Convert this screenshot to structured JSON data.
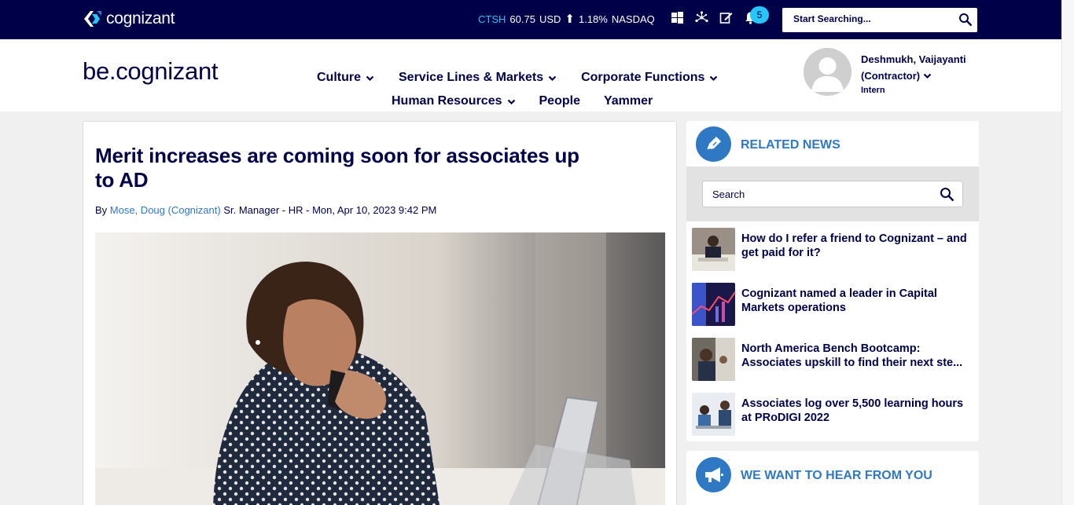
{
  "topbar": {
    "logo_text": "cognizant",
    "stock": {
      "ticker": "CTSH",
      "price": "60.75",
      "currency": "USD",
      "arrow": "⬆",
      "change": "1.18%",
      "exchange": "NASDAQ"
    },
    "icons": [
      "windows-icon",
      "network-icon",
      "edit-icon",
      "bell-icon"
    ],
    "notification_count": "5",
    "search_placeholder": "Start Searching..."
  },
  "header": {
    "brand": "be.cognizant",
    "nav_row1": [
      {
        "label": "Culture",
        "dropdown": true
      },
      {
        "label": "Service Lines & Markets",
        "dropdown": true
      },
      {
        "label": "Corporate Functions",
        "dropdown": true
      }
    ],
    "nav_row2": [
      {
        "label": "Human Resources",
        "dropdown": true
      },
      {
        "label": "People",
        "dropdown": false
      },
      {
        "label": "Yammer",
        "dropdown": false
      }
    ],
    "user": {
      "name_line1": "Deshmukh, Vaijayanti",
      "name_line2": "(Contractor)",
      "role": "Intern"
    }
  },
  "article": {
    "title": "Merit increases are coming soon for associates up to AD",
    "byline_prefix": "By",
    "author": "Mose, Doug (Cognizant)",
    "author_title": "Sr. Manager - HR",
    "separator": "-",
    "date": "Mon, Apr 10, 2023 9:42 PM"
  },
  "related_news": {
    "title": "RELATED NEWS",
    "search_placeholder": "Search",
    "items": [
      {
        "title": "How do I refer a friend to Cognizant – and get paid for it?"
      },
      {
        "title": "Cognizant named a leader in Capital Markets operations"
      },
      {
        "title_line1": "North America Bench Bootcamp:",
        "title_line2": "Associates upskill to find their next ste..."
      },
      {
        "title": "Associates log over 5,500 learning hours at PRoDIGI 2022"
      }
    ]
  },
  "hear_from_you": {
    "title": "WE WANT TO HEAR FROM YOU"
  },
  "colors": {
    "navy": "#000048",
    "accent_blue": "#2f78c4",
    "cyan": "#26c6f9"
  }
}
